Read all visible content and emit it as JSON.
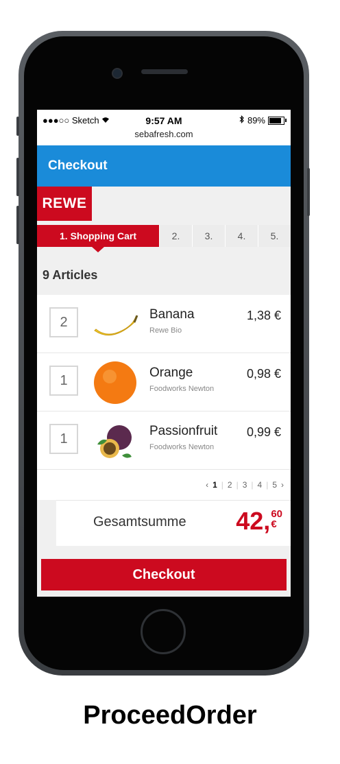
{
  "status_bar": {
    "carrier": "●●●○○ Sketch",
    "wifi_icon": "wifi-icon",
    "time": "9:57 AM",
    "bluetooth_icon": "bluetooth-icon",
    "battery": "89%",
    "url": "sebafresh.com"
  },
  "app_bar": {
    "title": "Checkout"
  },
  "brand": {
    "logo_text": "REWE"
  },
  "steps": {
    "active": "1. Shopping Cart",
    "s2": "2.",
    "s3": "3.",
    "s4": "4.",
    "s5": "5."
  },
  "cart": {
    "articles_label": "9 Articles",
    "items": [
      {
        "qty": "2",
        "name": "Banana",
        "brand": "Rewe Bio",
        "price": "1,38 €"
      },
      {
        "qty": "1",
        "name": "Orange",
        "brand": "Foodworks Newton",
        "price": "0,98 €"
      },
      {
        "qty": "1",
        "name": "Passionfruit",
        "brand": "Foodworks Newton",
        "price": "0,99 €"
      }
    ]
  },
  "pager": {
    "prev": "‹",
    "p1": "1",
    "p2": "2",
    "p3": "3",
    "p4": "4",
    "p5": "5",
    "next": "›",
    "sep": "|"
  },
  "total": {
    "label": "Gesamtsumme",
    "main": "42,",
    "cents": "60",
    "currency": "€"
  },
  "checkout_button": "Checkout",
  "caption": "ProceedOrder",
  "colors": {
    "accent_red": "#cc0a1f",
    "app_bar_blue": "#1a8bd9"
  }
}
